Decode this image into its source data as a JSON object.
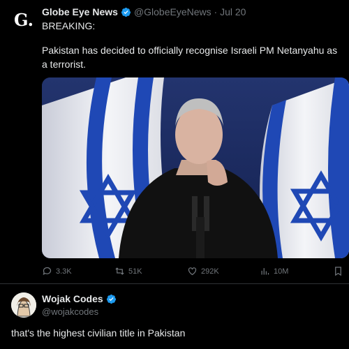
{
  "tweet": {
    "avatar_letter": "G.",
    "author_name": "Globe Eye News",
    "handle_date": "@GlobeEyeNews · Jul 20",
    "line1": "BREAKING:",
    "body": "Pakistan has decided to officially recognise Israeli PM Netanyahu as a terrorist.",
    "stats": {
      "replies": "3.3K",
      "reposts": "51K",
      "likes": "292K",
      "views": "10M"
    }
  },
  "reply": {
    "author_name": "Wojak Codes",
    "handle": "@wojakcodes",
    "text": "that's the highest civilian title in Pakistan"
  },
  "colors": {
    "background": "#000000",
    "text": "#e7e9ea",
    "muted": "#71767b",
    "verified": "#1d9bf0",
    "divider": "#2f3336"
  },
  "icons": [
    "verified-badge-icon",
    "reply-icon",
    "repost-icon",
    "like-icon",
    "views-icon",
    "bookmark-icon"
  ]
}
